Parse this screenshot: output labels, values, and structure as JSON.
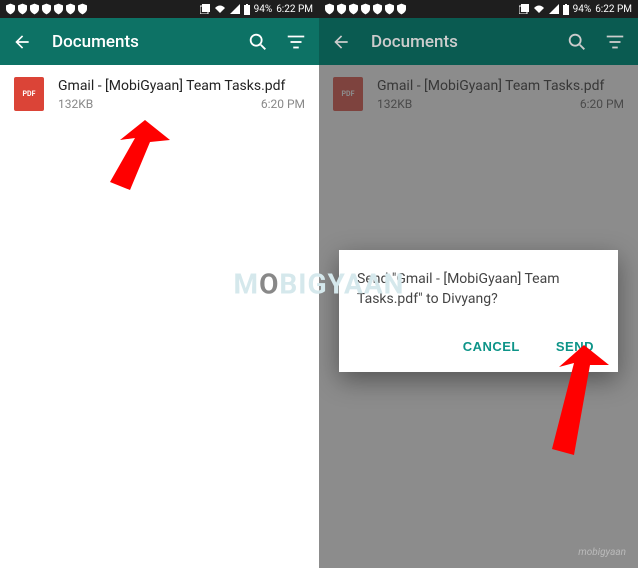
{
  "status_bar": {
    "battery": "94%",
    "time": "6:22 PM"
  },
  "app_bar": {
    "title": "Documents"
  },
  "document": {
    "name": "Gmail - [MobiGyaan] Team Tasks.pdf",
    "size": "132KB",
    "time": "6:20 PM"
  },
  "dialog": {
    "message": "Send \"Gmail - [MobiGyaan] Team Tasks.pdf\" to Divyang?",
    "cancel_label": "CANCEL",
    "send_label": "SEND"
  },
  "watermark": {
    "brand": "mobigyaan"
  }
}
